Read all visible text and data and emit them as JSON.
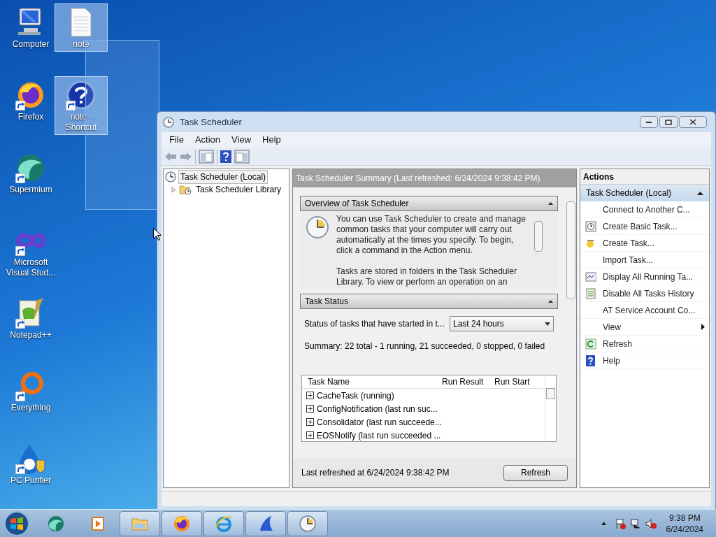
{
  "desktop": {
    "icons": [
      {
        "label": "Computer",
        "selected": false,
        "shortcut": false
      },
      {
        "label": "note",
        "selected": true,
        "shortcut": false
      },
      {
        "label": "Firefox",
        "selected": false,
        "shortcut": true
      },
      {
        "label": "note - Shortcut",
        "selected": true,
        "shortcut": true
      },
      {
        "label": "Supermium",
        "selected": false,
        "shortcut": true
      },
      {
        "label": "Microsoft Visual Stud...",
        "selected": false,
        "shortcut": true
      },
      {
        "label": "Notepad++",
        "selected": false,
        "shortcut": true
      },
      {
        "label": "Everything",
        "selected": false,
        "shortcut": true
      },
      {
        "label": "PC Purifier",
        "selected": false,
        "shortcut": true
      }
    ]
  },
  "window": {
    "title": "Task Scheduler",
    "menu": [
      "File",
      "Action",
      "View",
      "Help"
    ],
    "tree": [
      {
        "label": "Task Scheduler (Local)",
        "selected": true,
        "children": [
          {
            "label": "Task Scheduler Library",
            "selected": false,
            "expanded": false
          }
        ]
      }
    ],
    "summary": {
      "header": "Task Scheduler Summary (Last refreshed: 6/24/2024 9:38:42 PM)",
      "overview": {
        "title": "Overview of Task Scheduler",
        "paragraphs": [
          "You can use Task Scheduler to create and manage common tasks that your computer will carry out automatically at the times you specify. To begin, click a command in the Action menu.",
          "Tasks are stored in folders in the Task Scheduler Library. To view or perform an operation on an"
        ]
      },
      "task_status": {
        "title": "Task Status",
        "filter_label": "Status of tasks that have started in t...",
        "filter_value": "Last 24 hours",
        "summary": "Summary: 22 total - 1 running, 21 succeeded, 0 stopped, 0 failed",
        "table": {
          "columns": [
            "Task Name",
            "Run Result",
            "Run Start"
          ],
          "rows": [
            {
              "name": "CacheTask (running)"
            },
            {
              "name": "ConfigNotification (last run suc..."
            },
            {
              "name": "Consolidator (last run succeede..."
            },
            {
              "name": "EOSNotify (last run succeeded ..."
            }
          ]
        }
      },
      "last_refreshed": "Last refreshed at 6/24/2024 9:38:42 PM",
      "refresh_button": "Refresh"
    },
    "actions": {
      "title": "Actions",
      "group": "Task Scheduler (Local)",
      "items": [
        {
          "label": "Connect to Another C...",
          "kind": "item"
        },
        {
          "label": "Create Basic Task...",
          "kind": "item"
        },
        {
          "label": "Create Task...",
          "kind": "item"
        },
        {
          "label": "Import Task...",
          "kind": "item"
        },
        {
          "label": "Display All Running Ta...",
          "kind": "item"
        },
        {
          "label": "Disable All Tasks History",
          "kind": "item"
        },
        {
          "label": "AT Service Account Co...",
          "kind": "item"
        },
        {
          "label": "View",
          "kind": "submenu"
        },
        {
          "label": "Refresh",
          "kind": "item"
        },
        {
          "label": "Help",
          "kind": "item"
        }
      ]
    }
  },
  "taskbar": {
    "apps": [
      {
        "open": false
      },
      {
        "open": false
      },
      {
        "open": true
      },
      {
        "open": true
      },
      {
        "open": true
      },
      {
        "open": true
      },
      {
        "open": true
      }
    ],
    "time": "9:38 PM",
    "date": "6/24/2024"
  }
}
